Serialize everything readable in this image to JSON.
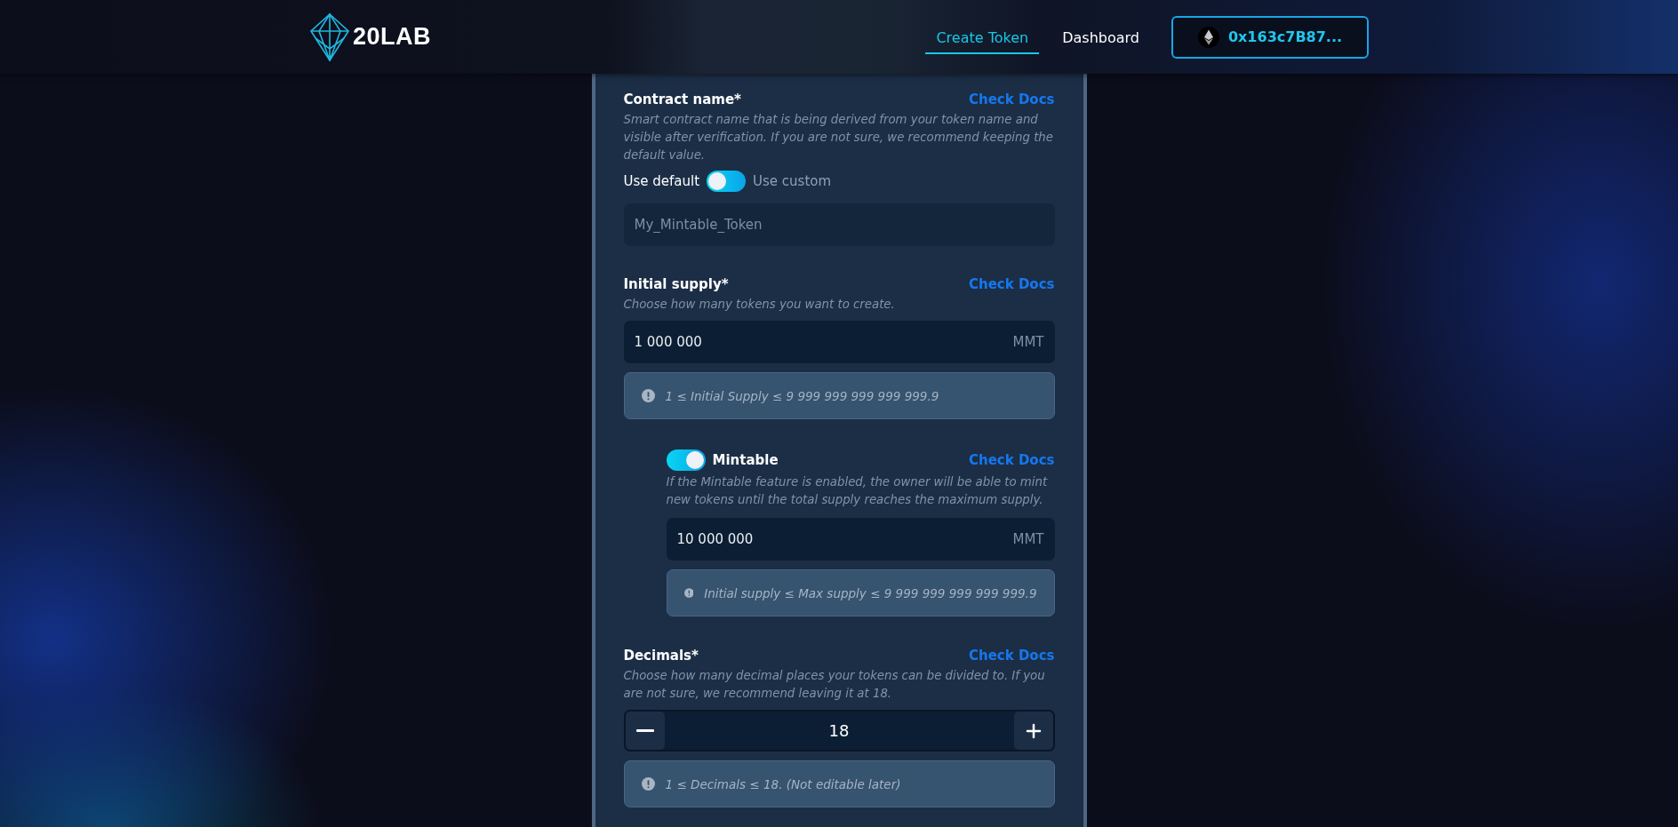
{
  "header": {
    "logo_text": "20LAB",
    "nav": [
      {
        "label": "Create Token",
        "selected": true
      },
      {
        "label": "Dashboard",
        "selected": false
      }
    ],
    "wallet": {
      "address": "0x163c7B87..."
    }
  },
  "sections": [
    {
      "kind": "name",
      "title": "Contract name*",
      "docs_link": "Check Docs",
      "description": "Smart contract name that is being derived from your token name and visible after verification. If you are not sure, we recommend keeping the default value.",
      "toggle": {
        "left_label": "Use default",
        "right_label": "Use custom",
        "on": false
      },
      "field": {
        "placeholder": "My_Mintable_Token"
      }
    },
    {
      "kind": "amount",
      "title": "Initial supply*",
      "docs_link": "Check Docs",
      "description": "Choose how many tokens you want to create.",
      "field": {
        "value": "1 000 000",
        "unit": "MMT"
      },
      "note": "1 ≤ Initial Supply ≤ 9 999 999 999 999 999.9",
      "options": [
        {
          "title": "Mintable",
          "on": true,
          "docs_link": "Check Docs",
          "description": "If the Mintable feature is enabled, the owner will be able to mint new tokens until the total supply reaches the maximum supply.",
          "field": {
            "value": "10 000 000",
            "unit": "MMT"
          },
          "note": "Initial supply ≤ Max supply ≤ 9 999 999 999 999 999.9"
        }
      ]
    },
    {
      "kind": "stepper",
      "title": "Decimals*",
      "docs_link": "Check Docs",
      "description": "Choose how many decimal places your tokens can be divided to. If you are not sure, we recommend leaving it at 18.",
      "field": {
        "value": "18"
      },
      "note": "1 ≤ Decimals ≤ 18. (Not editable later)"
    }
  ]
}
